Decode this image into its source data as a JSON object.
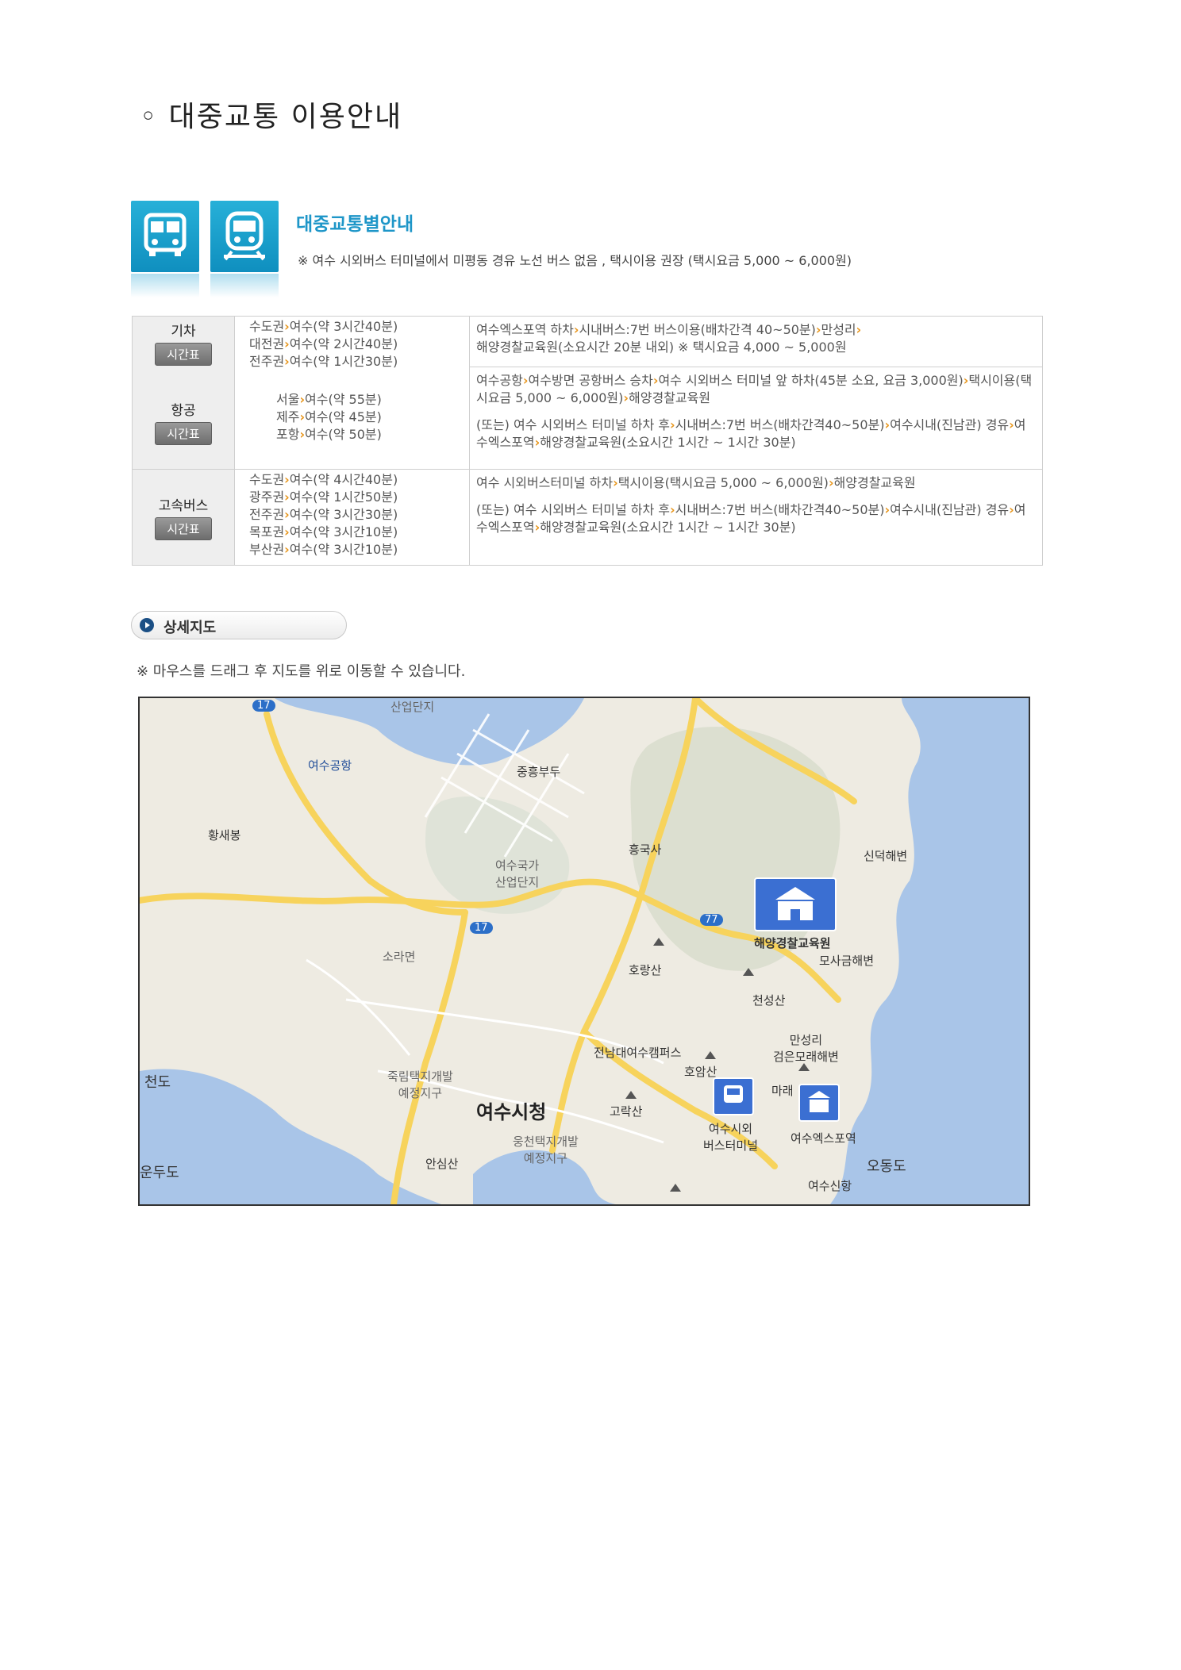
{
  "page_title": "◦ 대중교통 이용안내",
  "header": {
    "title": "대중교통별안내",
    "note": "※ 여수 시외버스 터미널에서 미평동 경유 노선 버스 없음 , 택시이용 권장 (택시요금 5,000 ~ 6,000원)"
  },
  "table": {
    "train": {
      "name": "기차",
      "button": "시간표",
      "routes": [
        {
          "from": "수도권",
          "to": "여수(약 3시간40분)"
        },
        {
          "from": "대전권",
          "to": "여수(약 2시간40분)"
        },
        {
          "from": "전주권",
          "to": "여수(약 1시간30분)"
        }
      ],
      "info": {
        "a": "여수엑스포역 하차",
        "b": "시내버스:7번 버스이용(배차간격 40~50분)",
        "c": "만성리",
        "d": "해양경찰교육원(소요시간 20분 내외) ※ 택시요금 4,000 ~ 5,000원"
      }
    },
    "air": {
      "name": "항공",
      "button": "시간표",
      "routes": [
        {
          "from": "서울",
          "to": "여수(약 55분)"
        },
        {
          "from": "제주",
          "to": "여수(약 45분)"
        },
        {
          "from": "포항",
          "to": "여수(약 50분)"
        }
      ],
      "info1": {
        "a": "여수공항",
        "b": "여수방면 공항버스 승차",
        "c": "여수 시외버스 터미널 앞 하차(45분 소요, 요금 3,000원)",
        "d": "택시이용(택시요금 5,000 ~ 6,000원)",
        "e": "해양경찰교육원"
      },
      "info2": {
        "a": "(또는) 여수 시외버스 터미널 하차 후",
        "b": "시내버스:7번 버스(배차간격40~50분)",
        "c": "여수시내(진남관) 경유",
        "d": "여수엑스포역",
        "e": "해양경찰교육원(소요시간 1시간 ~ 1시간 30분)"
      }
    },
    "bus": {
      "name": "고속버스",
      "button": "시간표",
      "routes": [
        {
          "from": "수도권",
          "to": "여수(약 4시간40분)"
        },
        {
          "from": "광주권",
          "to": "여수(약 1시간50분)"
        },
        {
          "from": "전주권",
          "to": "여수(약 3시간30분)"
        },
        {
          "from": "목포권",
          "to": "여수(약 3시간10분)"
        },
        {
          "from": "부산권",
          "to": "여수(약 3시간10분)"
        }
      ],
      "info1": {
        "a": "여수 시외버스터미널 하차",
        "b": "택시이용(택시요금 5,000 ~ 6,000원)",
        "c": "해양경찰교육원"
      },
      "info2": {
        "a": "(또는) 여수 시외버스 터미널 하차 후",
        "b": "시내버스:7번 버스(배차간격40~50분)",
        "c": "여수시내(진남관) 경유",
        "d": "여수엑스포역",
        "e": "해양경찰교육원(소요시간 1시간 ~ 1시간 30분)"
      }
    }
  },
  "detail_map": {
    "heading": "상세지도",
    "note": "※ 마우스를 드래그 후 지도를 위로 이동할 수 있습니다."
  },
  "map_labels": {
    "industrial": "산업단지",
    "airport": "여수공항",
    "pier": "중흥부두",
    "hwangsaebong": "황새봉",
    "heungguksa": "흥국사",
    "sinduk": "신덕해변",
    "national_industrial": "여수국가\n산업단지",
    "soramyeon": "소라면",
    "academy": "해양경찰교육원",
    "mosageum": "모사금해변",
    "horangsan": "호랑산",
    "cheonseongsan": "천성산",
    "manseongri": "만성리\n검은모래해변",
    "jnu": "전남대여수캠퍼스",
    "hoamsan": "호암산",
    "mare": "마래",
    "cheondo": "천도",
    "jukrim": "죽림택지개발\n예정지구",
    "cityhall": "여수시청",
    "gorak": "고락산",
    "terminal": "여수시외\n버스터미널",
    "expo": "여수엑스포역",
    "ungcheon": "웅천택지개발\n예정지구",
    "ansim": "안심산",
    "odongdo": "오동도",
    "undudo": "운두도",
    "sinhang": "여수신항",
    "route17": "17",
    "route77": "77"
  },
  "colors": {
    "accent": "#1e96c8",
    "arrow": "#e8961c",
    "sea": "#a9c5e8",
    "road": "#f7d35c"
  }
}
